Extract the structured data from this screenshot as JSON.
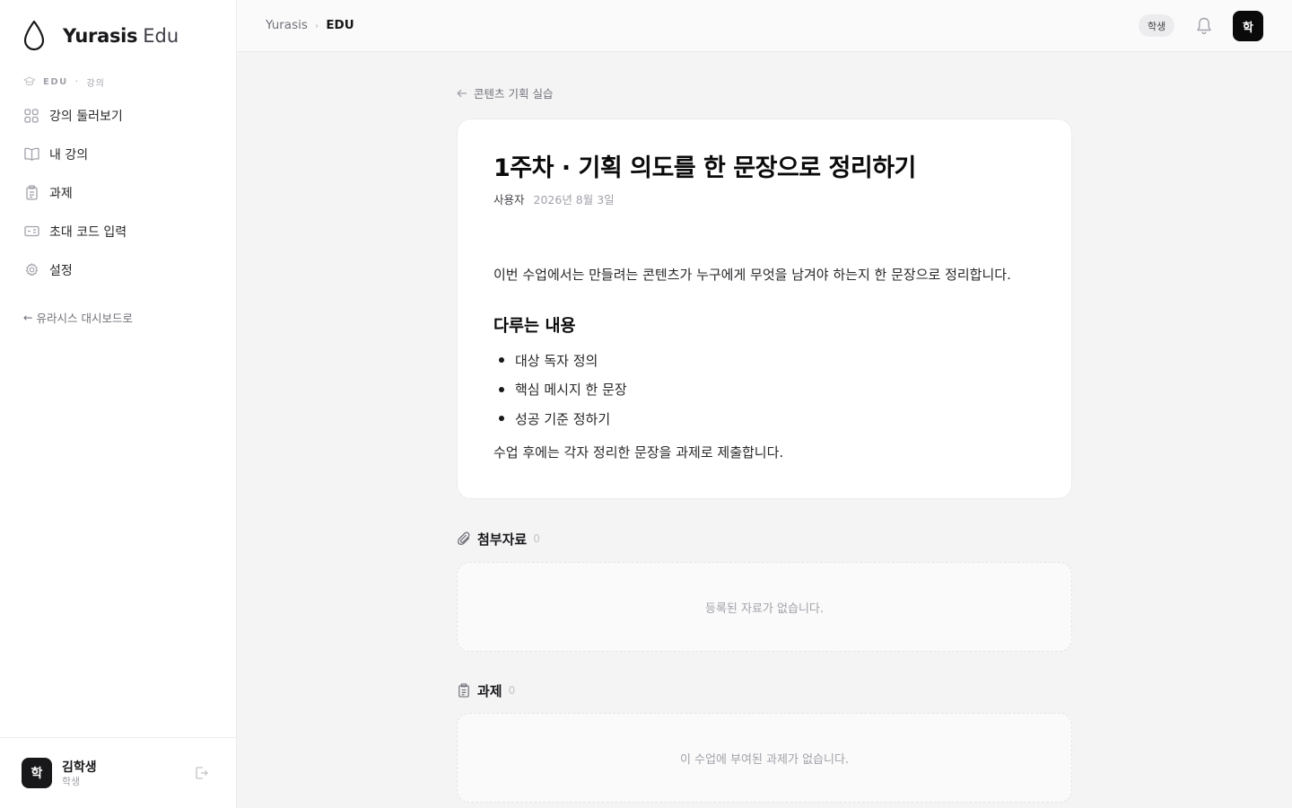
{
  "brand": {
    "name": "Yurasis",
    "sub": "Edu"
  },
  "sidebar": {
    "section_a": "EDU",
    "section_sep": "·",
    "section_b": "강의",
    "items": [
      {
        "label": "강의 둘러보기",
        "icon": "grid-icon"
      },
      {
        "label": "내 강의",
        "icon": "book-icon"
      },
      {
        "label": "과제",
        "icon": "clipboard-icon"
      },
      {
        "label": "초대 코드 입력",
        "icon": "ticket-icon"
      },
      {
        "label": "설정",
        "icon": "gear-icon"
      }
    ],
    "back_arrow": "←",
    "back_label": "유라시스 대시보드로"
  },
  "user": {
    "avatar": "학",
    "name": "김학생",
    "role": "학생"
  },
  "topbar": {
    "crumb_1": "Yurasis",
    "crumb_sep": "›",
    "crumb_2": "EDU",
    "role_badge": "학생",
    "avatar": "학"
  },
  "lesson": {
    "back_label": "콘텐츠 기획 실습",
    "title": "1주차 · 기획 의도를 한 문장으로 정리하기",
    "author": "사용자",
    "date": "2026년 8월 3일",
    "intro": "이번 수업에서는 만들려는 콘텐츠가 누구에게 무엇을 남겨야 하는지 한 문장으로 정리합니다.",
    "heading": "다루는 내용",
    "bullets": [
      "대상 독자 정의",
      "핵심 메시지 한 문장",
      "성공 기준 정하기"
    ],
    "outro": "수업 후에는 각자 정리한 문장을 과제로 제출합니다."
  },
  "attachments": {
    "title": "첨부자료",
    "count": "0",
    "empty": "등록된 자료가 없습니다."
  },
  "assignments": {
    "title": "과제",
    "count": "0",
    "empty": "이 수업에 부여된 과제가 없습니다."
  }
}
